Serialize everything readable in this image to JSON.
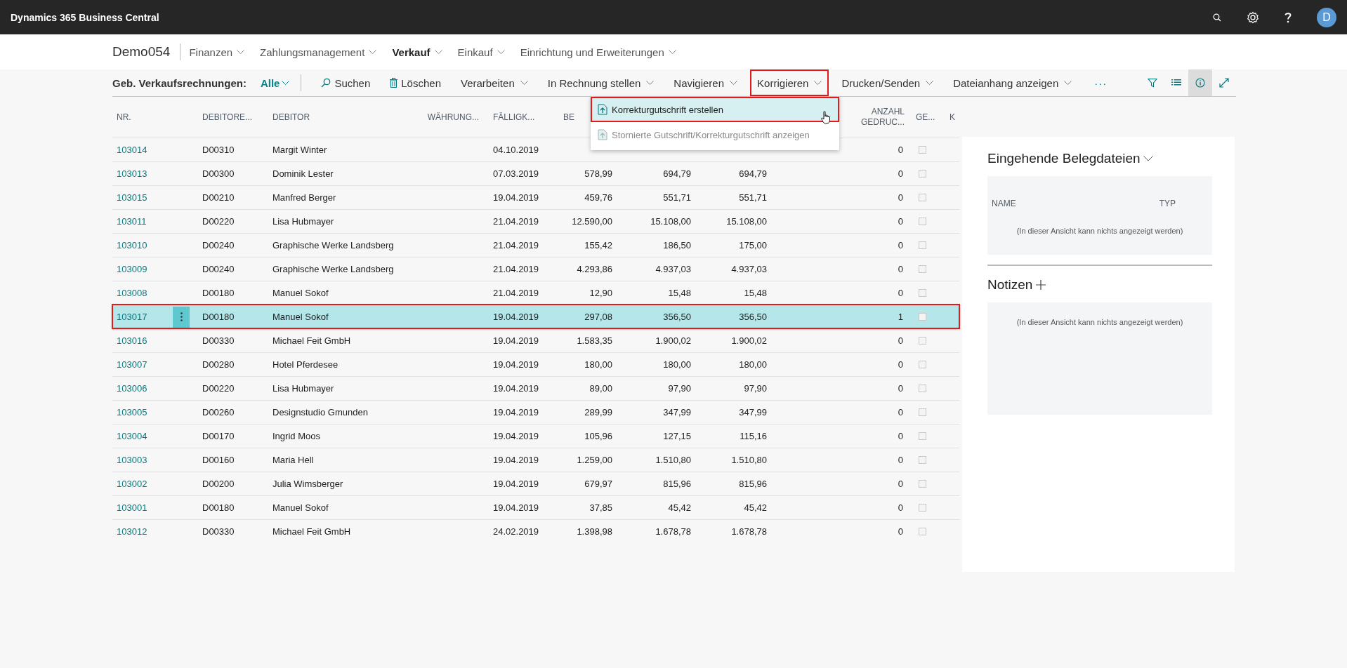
{
  "top_bar": {
    "brand": "Dynamics 365 Business Central",
    "avatar": "D"
  },
  "nav": {
    "company": "Demo054",
    "items": [
      {
        "label": "Finanzen",
        "selected": false
      },
      {
        "label": "Zahlungsmanagement",
        "selected": false
      },
      {
        "label": "Verkauf",
        "selected": true
      },
      {
        "label": "Einkauf",
        "selected": false
      },
      {
        "label": "Einrichtung und Erweiterungen",
        "selected": false
      }
    ]
  },
  "action_bar": {
    "page_title": "Geb. Verkaufsrechnungen:",
    "filter": "Alle",
    "actions": [
      {
        "label": "Suchen",
        "kind": "search",
        "highlighted": false
      },
      {
        "label": "Löschen",
        "kind": "delete",
        "highlighted": false
      },
      {
        "label": "Verarbeiten",
        "kind": "menu",
        "highlighted": false
      },
      {
        "label": "In Rechnung stellen",
        "kind": "menu",
        "highlighted": false
      },
      {
        "label": "Navigieren",
        "kind": "menu",
        "highlighted": false
      },
      {
        "label": "Korrigieren",
        "kind": "menu",
        "highlighted": true
      },
      {
        "label": "Drucken/Senden",
        "kind": "menu",
        "highlighted": false
      },
      {
        "label": "Dateianhang anzeigen",
        "kind": "menu",
        "highlighted": false
      }
    ],
    "more": "···",
    "tools": [
      {
        "kind": "filter",
        "selected": false
      },
      {
        "kind": "list",
        "selected": false
      },
      {
        "kind": "info",
        "selected": true
      },
      {
        "kind": "expand",
        "selected": false
      }
    ]
  },
  "dropdown_menu": {
    "items": [
      {
        "label": "Korrekturgutschrift erstellen",
        "selected": true,
        "disabled": false,
        "highlighted": true
      },
      {
        "label": "Stornierte Gutschrift/Korrekturgutschrift anzeigen",
        "selected": false,
        "disabled": true,
        "highlighted": false
      }
    ]
  },
  "table": {
    "columns": [
      "NR.",
      "DEBITORE...",
      "DEBITOR",
      "WÄHRUNG...",
      "FÄLLIGK...",
      "BE",
      "ANZAHL GEDRUC...",
      "GE...",
      "K"
    ],
    "rows": [
      {
        "nr": "103014",
        "customer_no": "D00310",
        "customer": "Margit Winter",
        "due_date": "04.10.2019",
        "printed": "0",
        "checked": false,
        "selected": false
      },
      {
        "nr": "103013",
        "customer_no": "D00300",
        "customer": "Dominik Lester",
        "due_date": "07.03.2019",
        "amount": "578,99",
        "amount_incl_vat": "694,79",
        "remaining": "694,79",
        "printed": "0",
        "checked": false,
        "selected": false
      },
      {
        "nr": "103015",
        "customer_no": "D00210",
        "customer": "Manfred Berger",
        "due_date": "19.04.2019",
        "amount": "459,76",
        "amount_incl_vat": "551,71",
        "remaining": "551,71",
        "printed": "0",
        "checked": false,
        "selected": false
      },
      {
        "nr": "103011",
        "customer_no": "D00220",
        "customer": "Lisa Hubmayer",
        "due_date": "21.04.2019",
        "amount": "12.590,00",
        "amount_incl_vat": "15.108,00",
        "remaining": "15.108,00",
        "printed": "0",
        "checked": false,
        "selected": false
      },
      {
        "nr": "103010",
        "customer_no": "D00240",
        "customer": "Graphische Werke Landsberg",
        "due_date": "21.04.2019",
        "amount": "155,42",
        "amount_incl_vat": "186,50",
        "remaining": "175,00",
        "printed": "0",
        "checked": false,
        "selected": false
      },
      {
        "nr": "103009",
        "customer_no": "D00240",
        "customer": "Graphische Werke Landsberg",
        "due_date": "21.04.2019",
        "amount": "4.293,86",
        "amount_incl_vat": "4.937,03",
        "remaining": "4.937,03",
        "printed": "0",
        "checked": false,
        "selected": false
      },
      {
        "nr": "103008",
        "customer_no": "D00180",
        "customer": "Manuel Sokof",
        "due_date": "21.04.2019",
        "amount": "12,90",
        "amount_incl_vat": "15,48",
        "remaining": "15,48",
        "printed": "0",
        "checked": false,
        "selected": false
      },
      {
        "nr": "103017",
        "customer_no": "D00180",
        "customer": "Manuel Sokof",
        "due_date": "19.04.2019",
        "amount": "297,08",
        "amount_incl_vat": "356,50",
        "remaining": "356,50",
        "printed": "1",
        "checked": false,
        "selected": true
      },
      {
        "nr": "103016",
        "customer_no": "D00330",
        "customer": "Michael Feit GmbH",
        "due_date": "19.04.2019",
        "amount": "1.583,35",
        "amount_incl_vat": "1.900,02",
        "remaining": "1.900,02",
        "printed": "0",
        "checked": false,
        "selected": false
      },
      {
        "nr": "103007",
        "customer_no": "D00280",
        "customer": "Hotel Pferdesee",
        "due_date": "19.04.2019",
        "amount": "180,00",
        "amount_incl_vat": "180,00",
        "remaining": "180,00",
        "printed": "0",
        "checked": false,
        "selected": false
      },
      {
        "nr": "103006",
        "customer_no": "D00220",
        "customer": "Lisa Hubmayer",
        "due_date": "19.04.2019",
        "amount": "89,00",
        "amount_incl_vat": "97,90",
        "remaining": "97,90",
        "printed": "0",
        "checked": false,
        "selected": false
      },
      {
        "nr": "103005",
        "customer_no": "D00260",
        "customer": "Designstudio Gmunden",
        "due_date": "19.04.2019",
        "amount": "289,99",
        "amount_incl_vat": "347,99",
        "remaining": "347,99",
        "printed": "0",
        "checked": false,
        "selected": false
      },
      {
        "nr": "103004",
        "customer_no": "D00170",
        "customer": "Ingrid Moos",
        "due_date": "19.04.2019",
        "amount": "105,96",
        "amount_incl_vat": "127,15",
        "remaining": "115,16",
        "printed": "0",
        "checked": false,
        "selected": false
      },
      {
        "nr": "103003",
        "customer_no": "D00160",
        "customer": "Maria Hell",
        "due_date": "19.04.2019",
        "amount": "1.259,00",
        "amount_incl_vat": "1.510,80",
        "remaining": "1.510,80",
        "printed": "0",
        "checked": false,
        "selected": false
      },
      {
        "nr": "103002",
        "customer_no": "D00200",
        "customer": "Julia Wimsberger",
        "due_date": "19.04.2019",
        "amount": "679,97",
        "amount_incl_vat": "815,96",
        "remaining": "815,96",
        "printed": "0",
        "checked": false,
        "selected": false
      },
      {
        "nr": "103001",
        "customer_no": "D00180",
        "customer": "Manuel Sokof",
        "due_date": "19.04.2019",
        "amount": "37,85",
        "amount_incl_vat": "45,42",
        "remaining": "45,42",
        "printed": "0",
        "checked": false,
        "selected": false
      },
      {
        "nr": "103012",
        "customer_no": "D00330",
        "customer": "Michael Feit GmbH",
        "due_date": "24.02.2019",
        "amount": "1.398,98",
        "amount_incl_vat": "1.678,78",
        "remaining": "1.678,78",
        "printed": "0",
        "checked": false,
        "selected": false
      }
    ]
  },
  "factbox": {
    "documents": {
      "title": "Eingehende Belegdateien",
      "columns": [
        "NAME",
        "TYP"
      ],
      "empty": "(In dieser Ansicht kann nichts angezeigt werden)"
    },
    "notes": {
      "title": "Notizen",
      "empty": "(In dieser Ansicht kann nichts angezeigt werden)"
    }
  }
}
